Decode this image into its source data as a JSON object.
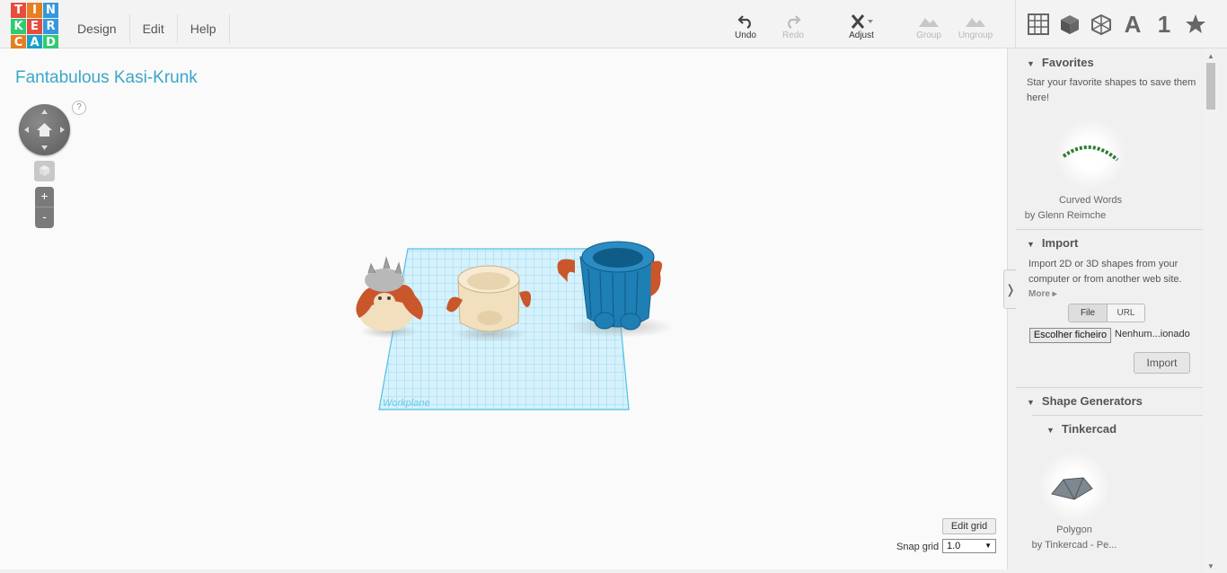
{
  "logo": {
    "letters": [
      "T",
      "I",
      "N",
      "K",
      "E",
      "R",
      "C",
      "A",
      "D"
    ],
    "colors": [
      "#e74c3c",
      "#e67e22",
      "#3498db",
      "#2ecc71",
      "#e74c3c",
      "#3498db",
      "#e67e22",
      "#1aa0c8",
      "#2ecc71"
    ]
  },
  "menu": {
    "design": "Design",
    "edit": "Edit",
    "help": "Help"
  },
  "toolbar": {
    "undo": "Undo",
    "redo": "Redo",
    "adjust": "Adjust",
    "group": "Group",
    "ungroup": "Ungroup"
  },
  "view_icons": {
    "number": "A",
    "one": "1"
  },
  "workspace": {
    "title": "Fantabulous Kasi-Krunk",
    "help": "?",
    "zoom_in": "+",
    "zoom_out": "-",
    "workplane_label": "Workplane",
    "edit_grid": "Edit grid",
    "snap_label": "Snap grid",
    "snap_value": "1.0"
  },
  "sidebar": {
    "favorites": {
      "title": "Favorites",
      "text": "Star your favorite shapes to save them here!",
      "shape_name": "Curved Words",
      "shape_author": "by Glenn Reimche"
    },
    "import": {
      "title": "Import",
      "text": "Import 2D or 3D shapes from your computer or from another web site.",
      "more": "More",
      "tab_file": "File",
      "tab_url": "URL",
      "choose": "Escolher ficheiro",
      "nofile": "Nenhum...ionado",
      "button": "Import"
    },
    "generators": {
      "title": "Shape Generators",
      "sub": "Tinkercad",
      "shape_name": "Polygon",
      "shape_author": "by Tinkercad - Pe..."
    }
  },
  "colors": {
    "accent": "#3aa7c7",
    "grid": "#7fd4f0",
    "blue_model": "#1e7fb5",
    "orange_model": "#c9572b",
    "cream_model": "#f1dfbd"
  }
}
